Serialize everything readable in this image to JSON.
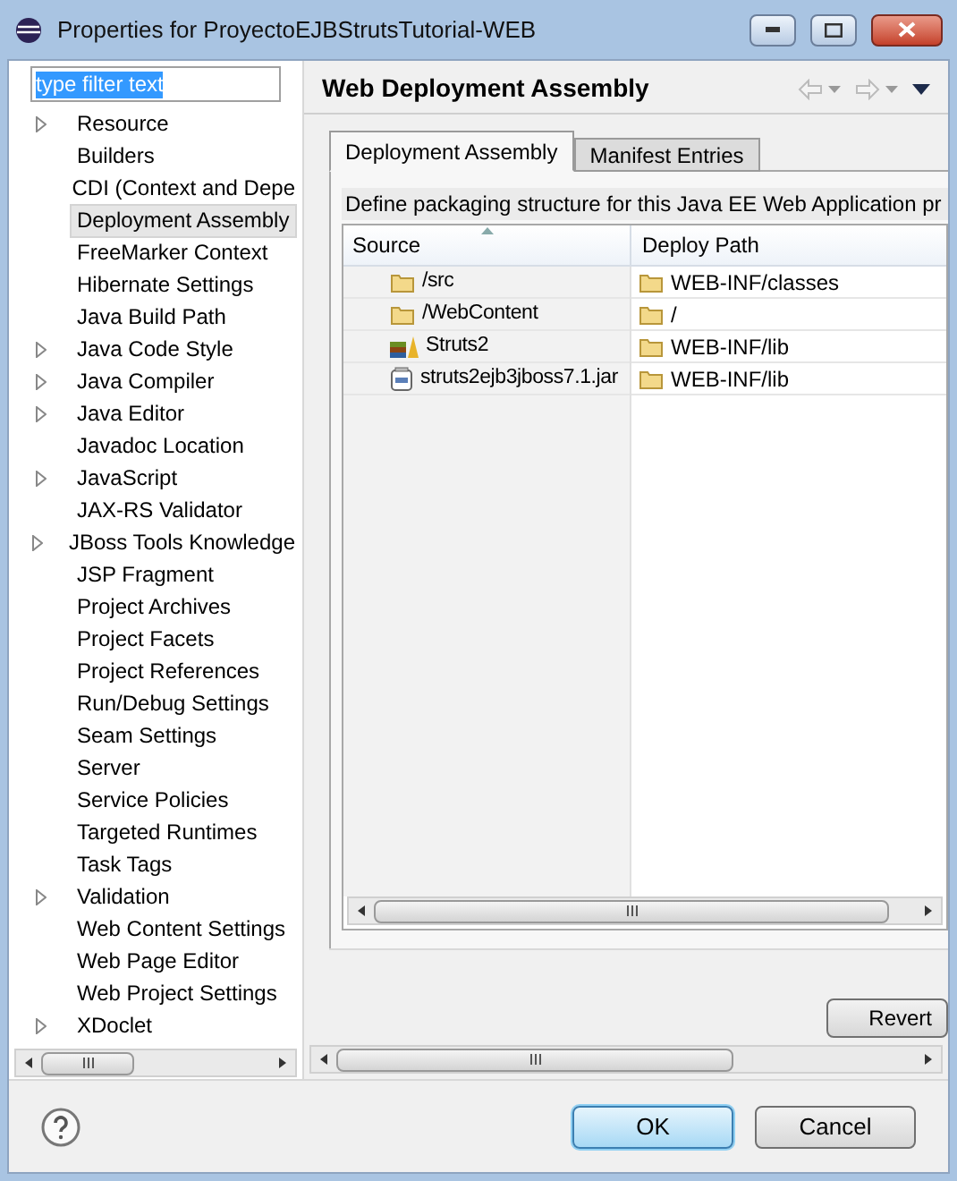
{
  "window": {
    "title": "Properties for ProyectoEJBStrutsTutorial-WEB"
  },
  "filter": {
    "value": "type filter text"
  },
  "tree": [
    {
      "label": "Resource",
      "expandable": true,
      "selected": false
    },
    {
      "label": "Builders",
      "expandable": false,
      "selected": false
    },
    {
      "label": "CDI (Context and Depe",
      "expandable": false,
      "selected": false
    },
    {
      "label": "Deployment Assembly",
      "expandable": false,
      "selected": true
    },
    {
      "label": "FreeMarker Context",
      "expandable": false,
      "selected": false
    },
    {
      "label": "Hibernate Settings",
      "expandable": false,
      "selected": false
    },
    {
      "label": "Java Build Path",
      "expandable": false,
      "selected": false
    },
    {
      "label": "Java Code Style",
      "expandable": true,
      "selected": false
    },
    {
      "label": "Java Compiler",
      "expandable": true,
      "selected": false
    },
    {
      "label": "Java Editor",
      "expandable": true,
      "selected": false
    },
    {
      "label": "Javadoc Location",
      "expandable": false,
      "selected": false
    },
    {
      "label": "JavaScript",
      "expandable": true,
      "selected": false
    },
    {
      "label": "JAX-RS Validator",
      "expandable": false,
      "selected": false
    },
    {
      "label": "JBoss Tools Knowledge",
      "expandable": true,
      "selected": false
    },
    {
      "label": "JSP Fragment",
      "expandable": false,
      "selected": false
    },
    {
      "label": "Project Archives",
      "expandable": false,
      "selected": false
    },
    {
      "label": "Project Facets",
      "expandable": false,
      "selected": false
    },
    {
      "label": "Project References",
      "expandable": false,
      "selected": false
    },
    {
      "label": "Run/Debug Settings",
      "expandable": false,
      "selected": false
    },
    {
      "label": "Seam Settings",
      "expandable": false,
      "selected": false
    },
    {
      "label": "Server",
      "expandable": false,
      "selected": false
    },
    {
      "label": "Service Policies",
      "expandable": false,
      "selected": false
    },
    {
      "label": "Targeted Runtimes",
      "expandable": false,
      "selected": false
    },
    {
      "label": "Task Tags",
      "expandable": false,
      "selected": false
    },
    {
      "label": "Validation",
      "expandable": true,
      "selected": false
    },
    {
      "label": "Web Content Settings",
      "expandable": false,
      "selected": false
    },
    {
      "label": "Web Page Editor",
      "expandable": false,
      "selected": false
    },
    {
      "label": "Web Project Settings",
      "expandable": false,
      "selected": false
    },
    {
      "label": "XDoclet",
      "expandable": true,
      "selected": false
    }
  ],
  "page": {
    "title": "Web Deployment Assembly",
    "tabs": [
      {
        "label": "Deployment Assembly",
        "selected": true
      },
      {
        "label": "Manifest Entries",
        "selected": false
      }
    ],
    "description": "Define packaging structure for this Java EE Web Application pr",
    "table": {
      "columns": [
        "Source",
        "Deploy Path"
      ],
      "rows": [
        {
          "source": "/src",
          "kind": "folder",
          "deploy_path": "WEB-INF/classes"
        },
        {
          "source": "/WebContent",
          "kind": "folder",
          "deploy_path": "/"
        },
        {
          "source": "Struts2",
          "kind": "library",
          "deploy_path": "WEB-INF/lib"
        },
        {
          "source": "struts2ejb3jboss7.1.jar",
          "kind": "jar",
          "deploy_path": "WEB-INF/lib"
        }
      ]
    },
    "revert_button": "Revert"
  },
  "buttons": {
    "ok": "OK",
    "cancel": "Cancel"
  }
}
